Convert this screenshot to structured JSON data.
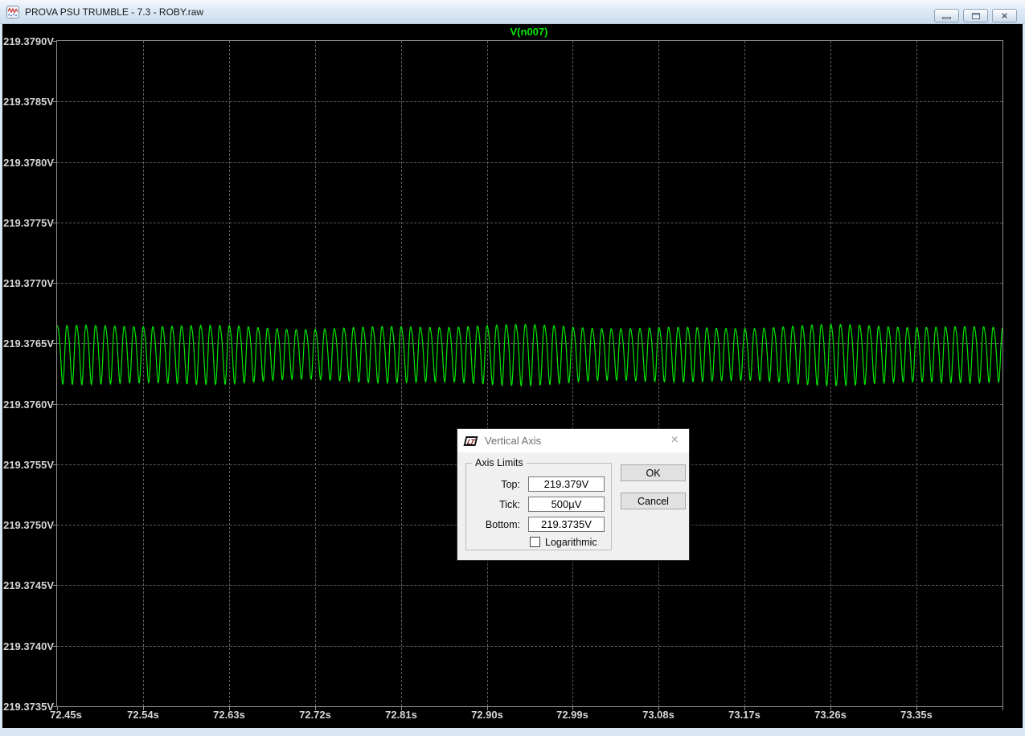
{
  "window": {
    "title": "PROVA PSU TRUMBLE - 7.3 - ROBY.raw",
    "controls": {
      "minimize": "minimize",
      "restore": "restore",
      "close_glyph": "×"
    }
  },
  "chart_data": {
    "type": "line",
    "title": "V(n007)",
    "x_unit": "s",
    "y_unit": "V",
    "grid": true,
    "legend_position": "top-center",
    "x_tick_labels": [
      "72.45s",
      "72.54s",
      "72.63s",
      "72.72s",
      "72.81s",
      "72.90s",
      "72.99s",
      "73.08s",
      "73.17s",
      "73.26s",
      "73.35s"
    ],
    "x_tick_values": [
      72.45,
      72.54,
      72.63,
      72.72,
      72.81,
      72.9,
      72.99,
      73.08,
      73.17,
      73.26,
      73.35
    ],
    "x_range": [
      72.45,
      73.44
    ],
    "x_tick_step": 0.09,
    "y_tick_labels": [
      "219.3790V",
      "219.3785V",
      "219.3780V",
      "219.3775V",
      "219.3770V",
      "219.3765V",
      "219.3760V",
      "219.3755V",
      "219.3750V",
      "219.3745V",
      "219.3740V",
      "219.3735V"
    ],
    "y_tick_values": [
      219.379,
      219.3785,
      219.378,
      219.3775,
      219.377,
      219.3765,
      219.376,
      219.3755,
      219.375,
      219.3745,
      219.374,
      219.3735
    ],
    "y_range": [
      219.3735,
      219.379
    ],
    "y_tick_step_v": 0.0005,
    "series": [
      {
        "name": "V(n007)",
        "color": "#00e800",
        "waveform": {
          "shape": "ripple-sine",
          "frequency_hz": 100,
          "cycles_visible": 99,
          "mean_v": 219.37643,
          "amplitude_v": 0.00025,
          "max_v": 219.37668,
          "min_v": 219.37618
        }
      }
    ],
    "grid_color": "#5c5c5c",
    "axis_text_color": "#d6d6d6",
    "background": "#000000"
  },
  "dialog": {
    "title": "Vertical Axis",
    "close_glyph": "×",
    "icon_text": "LT",
    "group_label": "Axis Limits",
    "fields": [
      {
        "label": "Top:",
        "value": "219.379V"
      },
      {
        "label": "Tick:",
        "value": "500µV"
      },
      {
        "label": "Bottom:",
        "value": "219.3735V"
      }
    ],
    "checkbox": {
      "label": "Logarithmic",
      "checked": false
    },
    "buttons": {
      "ok": "OK",
      "cancel": "Cancel"
    }
  }
}
